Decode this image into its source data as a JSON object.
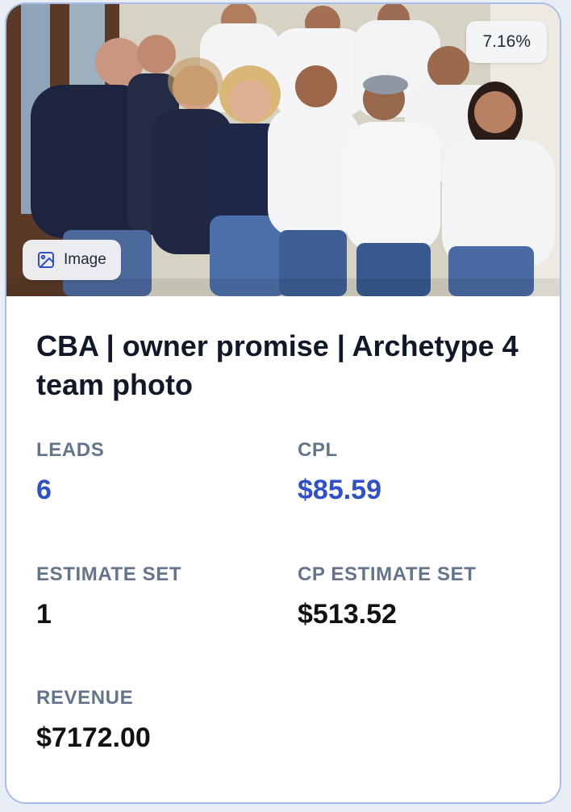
{
  "card": {
    "percent_badge": "7.16%",
    "media_type_label": "Image",
    "media_icon": "image-icon",
    "title": "CBA | owner promise | Archetype 4 team photo",
    "metrics": [
      {
        "label": "LEADS",
        "value": "6"
      },
      {
        "label": "CPL",
        "value": "$85.59"
      },
      {
        "label": "ESTIMATE SET",
        "value": "1"
      },
      {
        "label": "CP ESTIMATE SET",
        "value": "$513.52"
      },
      {
        "label": "REVENUE",
        "value": "$7172.00"
      }
    ]
  },
  "colors": {
    "border": "#a9bde8",
    "accent": "#2f50c8",
    "label": "#64748b",
    "text": "#111111"
  }
}
